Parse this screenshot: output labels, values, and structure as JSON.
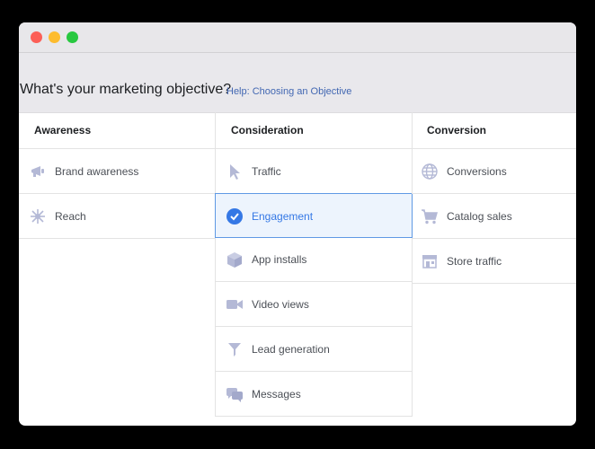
{
  "header": {
    "title": "What's your marketing objective?",
    "help_link": "Help: Choosing an Objective"
  },
  "columns": [
    {
      "title": "Awareness",
      "items": [
        {
          "label": "Brand awareness",
          "icon": "megaphone-icon"
        },
        {
          "label": "Reach",
          "icon": "reach-icon"
        }
      ]
    },
    {
      "title": "Consideration",
      "items": [
        {
          "label": "Traffic",
          "icon": "cursor-icon"
        },
        {
          "label": "Engagement",
          "icon": "check-circle-icon",
          "selected": true
        },
        {
          "label": "App installs",
          "icon": "box-icon"
        },
        {
          "label": "Video views",
          "icon": "video-camera-icon"
        },
        {
          "label": "Lead generation",
          "icon": "funnel-icon"
        },
        {
          "label": "Messages",
          "icon": "chat-bubbles-icon"
        }
      ]
    },
    {
      "title": "Conversion",
      "items": [
        {
          "label": "Conversions",
          "icon": "globe-icon"
        },
        {
          "label": "Catalog sales",
          "icon": "cart-icon"
        },
        {
          "label": "Store traffic",
          "icon": "store-icon"
        }
      ]
    }
  ],
  "colors": {
    "icon": "#b4b9d6",
    "selected_accent": "#3578e5",
    "selected_bg": "#edf4fd",
    "link": "#4267b2"
  }
}
